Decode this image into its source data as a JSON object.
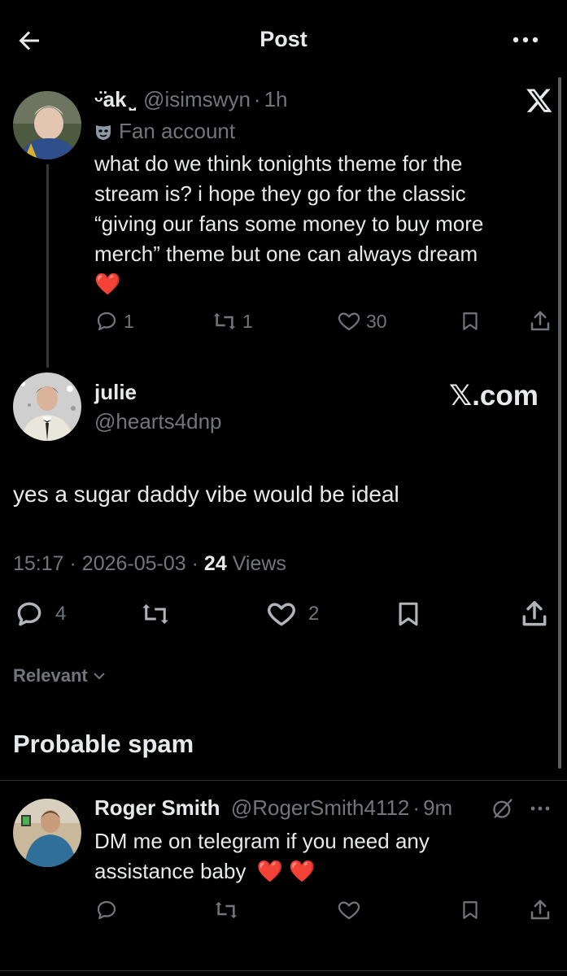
{
  "header": {
    "title": "Post"
  },
  "parent_post": {
    "name": "ᵕ̈ak ̤̮",
    "handle": "@isimswyn",
    "sep": "·",
    "time": "1h",
    "badge": "Fan account",
    "text_lines": [
      "what do we think tonights theme for the",
      "stream is? i hope they go for the classic",
      "“giving our fans some money to buy more",
      "merch” theme but one can always dream"
    ],
    "emoji": "❤️",
    "replies": "1",
    "reposts": "1",
    "likes": "30"
  },
  "main_post": {
    "name": "julie",
    "handle": "@hearts4dnp",
    "watermark": "𝕏.com",
    "text": "yes a sugar daddy vibe would be ideal",
    "time": "15:17",
    "date": "2026-05-03",
    "sep": "·",
    "views_count": "24",
    "views_label": "Views",
    "replies": "4",
    "likes": "2"
  },
  "sort": {
    "label": "Relevant"
  },
  "spam_section": {
    "title": "Probable spam"
  },
  "reply": {
    "name": "Roger Smith",
    "handle": "@RogerSmith4112",
    "sep": "·",
    "time": "9m",
    "text_line1": "DM me on telegram if you need any",
    "text_line2": "assistance baby",
    "emoji": "❤️ ❤️"
  },
  "colors": {
    "background": "#000000",
    "text": "#e7e9ea",
    "muted": "#71767b",
    "divider": "#2f3336"
  }
}
